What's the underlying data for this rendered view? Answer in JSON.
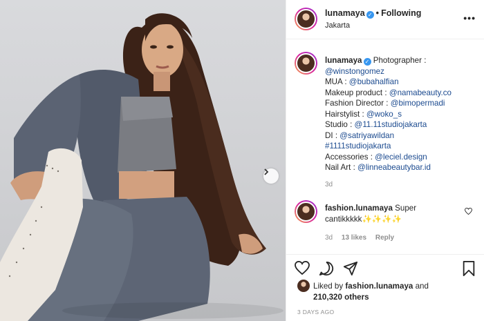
{
  "post": {
    "username": "lunamaya",
    "verified_mark": "✓",
    "dot": "•",
    "follow_status": "Following",
    "location": "Jakarta",
    "more_icon": "•••"
  },
  "caption": {
    "username": "lunamaya",
    "lines": [
      {
        "text": "Photographer :",
        "link": ""
      },
      {
        "text": "",
        "link": "@winstongomez"
      },
      {
        "text": "MUA : ",
        "link": "@bubahalfian"
      },
      {
        "text": "Makeup product : ",
        "link": "@namabeauty.co"
      },
      {
        "text": "Fashion Director : ",
        "link": "@bimopermadi"
      },
      {
        "text": "Hairstylist : ",
        "link": "@woko_s"
      },
      {
        "text": "Studio : ",
        "link": "@11.11studiojakarta"
      },
      {
        "text": "DI : ",
        "link": "@satriyawildan"
      },
      {
        "text": "",
        "link": "#1111studiojakarta"
      },
      {
        "text": "Accessories : ",
        "link": "@leciel.design"
      },
      {
        "text": "Nail Art : ",
        "link": "@linneabeautybar.id"
      }
    ],
    "age": "3d"
  },
  "comment": {
    "username": "fashion.lunamaya",
    "text": "Super cantikkkkk",
    "emoji": "✨✨✨✨",
    "age": "3d",
    "likes": "13 likes",
    "reply": "Reply"
  },
  "likes": {
    "prefix": "Liked by ",
    "liker": "fashion.lunamaya",
    "middle": " and",
    "count": "210,320 others"
  },
  "timestamp": "3 DAYS AGO",
  "icons": [
    "heart-icon",
    "comment-icon",
    "share-icon",
    "bookmark-icon",
    "next-arrow-icon",
    "more-icon"
  ],
  "colors": {
    "link": "#1b4a8f",
    "verified": "#3897f0",
    "muted": "#8e8e8e"
  }
}
